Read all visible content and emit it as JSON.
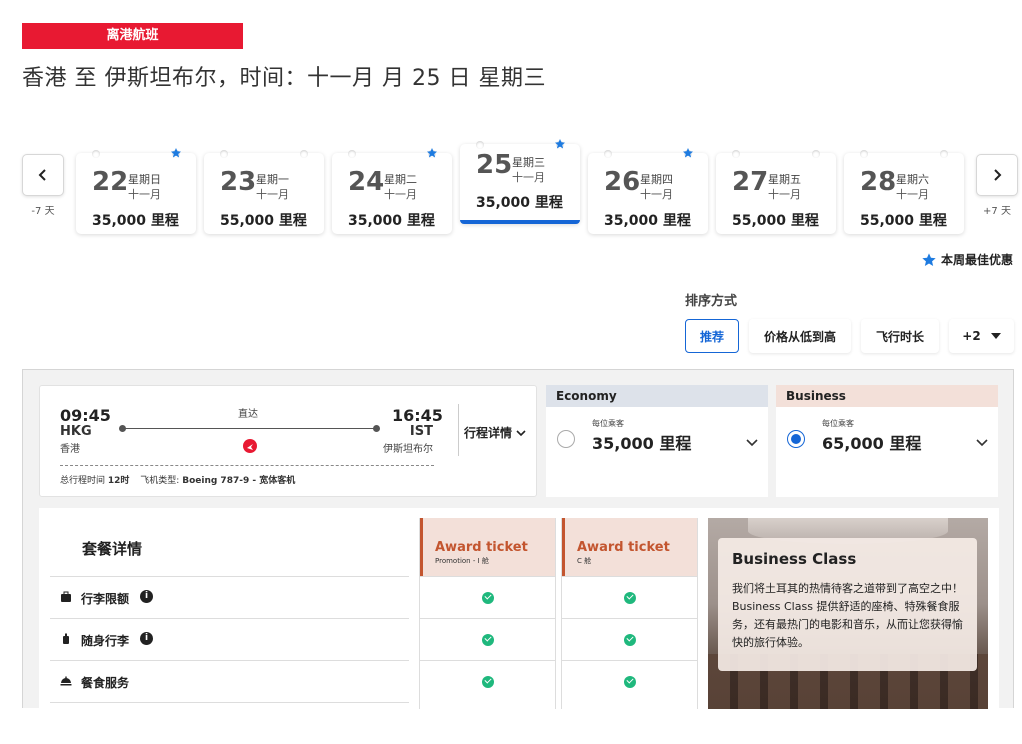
{
  "header": {
    "badge": "离港航班",
    "title": "香港 至 伊斯坦布尔，时间：十一月 月 25 日 星期三"
  },
  "date_nav": {
    "prev_label": "-7 天",
    "next_label": "+7 天",
    "dates": [
      {
        "day": "22",
        "weekday": "星期日",
        "month": "十一月",
        "price": "35,000 里程",
        "best": true,
        "selected": false
      },
      {
        "day": "23",
        "weekday": "星期一",
        "month": "十一月",
        "price": "55,000 里程",
        "best": false,
        "selected": false
      },
      {
        "day": "24",
        "weekday": "星期二",
        "month": "十一月",
        "price": "35,000 里程",
        "best": true,
        "selected": false
      },
      {
        "day": "25",
        "weekday": "星期三",
        "month": "十一月",
        "price": "35,000 里程",
        "best": true,
        "selected": true
      },
      {
        "day": "26",
        "weekday": "星期四",
        "month": "十一月",
        "price": "35,000 里程",
        "best": true,
        "selected": false
      },
      {
        "day": "27",
        "weekday": "星期五",
        "month": "十一月",
        "price": "55,000 里程",
        "best": false,
        "selected": false
      },
      {
        "day": "28",
        "weekday": "星期六",
        "month": "十一月",
        "price": "55,000 里程",
        "best": false,
        "selected": false
      }
    ],
    "best_deal_label": "本周最佳优惠",
    "star_color": "#1e7be0",
    "selected_color": "#1566d6"
  },
  "sort": {
    "label": "排序方式",
    "options": [
      "推荐",
      "价格从低到高",
      "飞行时长",
      "+2"
    ],
    "active": "推荐"
  },
  "flight": {
    "dep_time": "09:45",
    "dep_code": "HKG",
    "dep_city": "香港",
    "arr_time": "16:45",
    "arr_code": "IST",
    "arr_city": "伊斯坦布尔",
    "stops": "直达",
    "total_time_label": "总行程时间",
    "total_time": "12时",
    "aircraft_label": "飞机类型:",
    "aircraft": "Boeing 787-9 - 宽体客机",
    "details_label": "行程详情"
  },
  "fares": [
    {
      "cabin": "Economy",
      "per_pax": "每位乘客",
      "price": "35,000 里程",
      "selected": false,
      "head_color": "#dde2ea"
    },
    {
      "cabin": "Business",
      "per_pax": "每位乘客",
      "price": "65,000 里程",
      "selected": true,
      "head_color": "#f3e0d9"
    }
  ],
  "package": {
    "title": "套餐详情",
    "rows": [
      {
        "label": "行李限额",
        "icon": "suitcase-icon",
        "info": true
      },
      {
        "label": "随身行李",
        "icon": "carry-on-icon",
        "info": true
      },
      {
        "label": "餐食服务",
        "icon": "meal-icon",
        "info": false
      }
    ],
    "tickets": [
      {
        "name": "Award ticket",
        "sub": "Promotion - I 舱"
      },
      {
        "name": "Award ticket",
        "sub": "C 舱"
      }
    ],
    "cabin_info": {
      "title": "Business Class",
      "desc": "我们将土耳其的热情待客之道带到了高空之中！Business Class 提供舒适的座椅、特殊餐食服务，还有最热门的电影和音乐，从而让您获得愉快的旅行体验。"
    },
    "check_color": "#1fb87d",
    "accent_color": "#c3552f"
  },
  "info_icon_glyph": "i"
}
